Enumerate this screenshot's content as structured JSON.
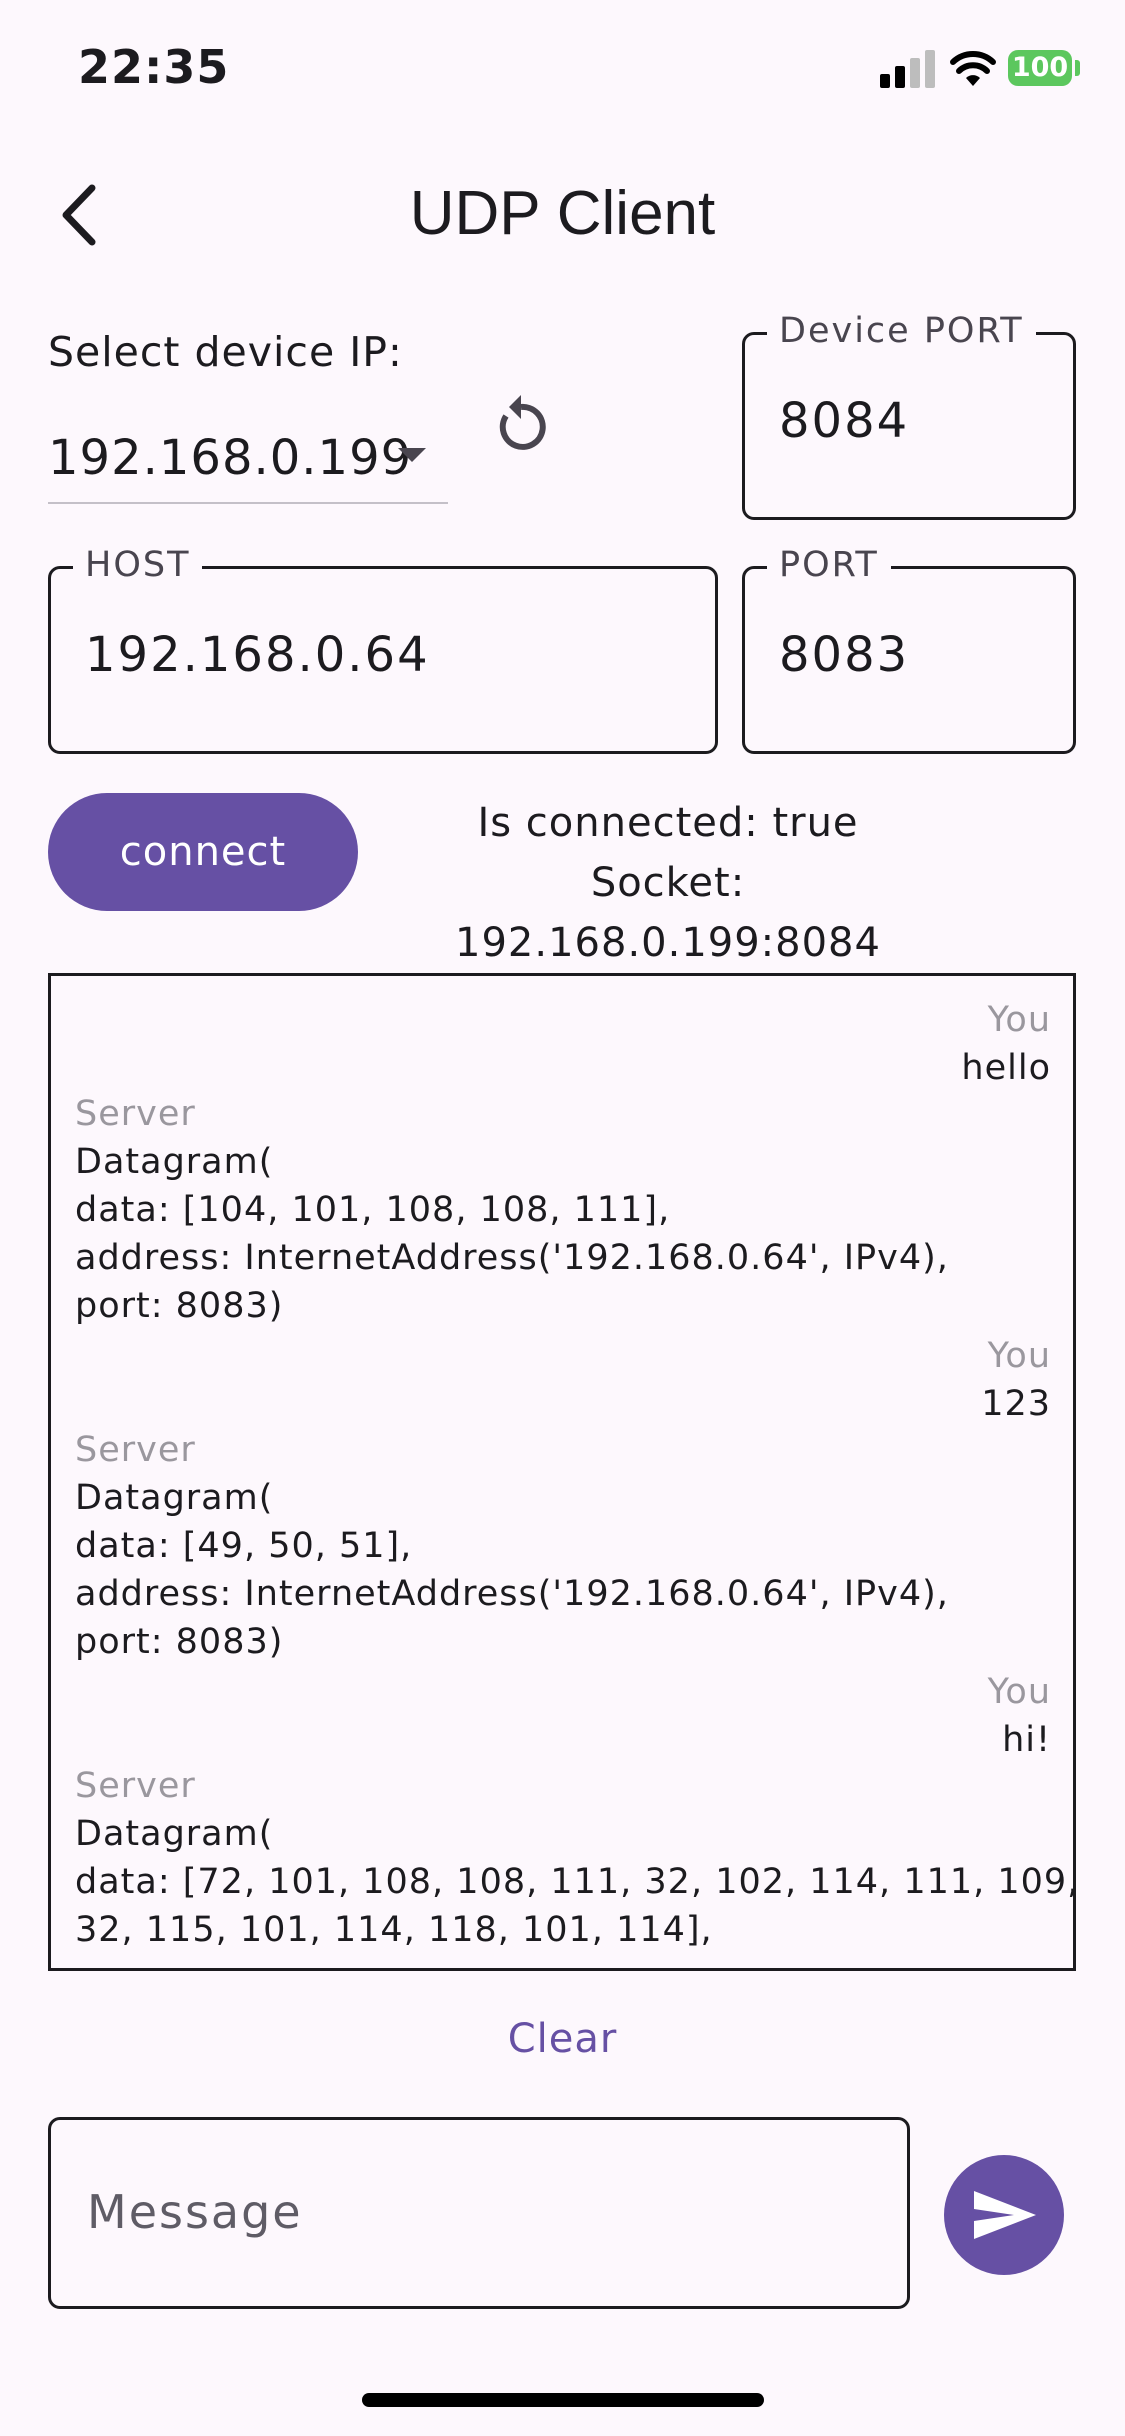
{
  "status_bar": {
    "time": "22:35",
    "battery": "100",
    "icons": [
      "signal-icon",
      "wifi-icon",
      "battery-icon"
    ]
  },
  "app_bar": {
    "title": "UDP Client",
    "back_icon": "chevron-left-icon"
  },
  "device_ip": {
    "label": "Select device IP:",
    "value": "192.168.0.199",
    "refresh_icon": "refresh-icon"
  },
  "device_port": {
    "label": "Device PORT",
    "value": "8084"
  },
  "host": {
    "label": "HOST",
    "value": "192.168.0.64"
  },
  "port": {
    "label": "PORT",
    "value": "8083"
  },
  "connect": {
    "label": "connect"
  },
  "connection": {
    "is_connected": "Is connected: true",
    "socket": "Socket: 192.168.0.199:8084"
  },
  "messages": [
    {
      "sender": "You",
      "text": "hello"
    },
    {
      "sender": "Server",
      "text": "Datagram(\ndata: [104, 101, 108, 108, 111],\naddress: InternetAddress('192.168.0.64', IPv4),\nport: 8083)"
    },
    {
      "sender": "You",
      "text": "123"
    },
    {
      "sender": "Server",
      "text": "Datagram(\ndata: [49, 50, 51],\naddress: InternetAddress('192.168.0.64', IPv4),\nport: 8083)"
    },
    {
      "sender": "You",
      "text": "hi!"
    },
    {
      "sender": "Server",
      "text": "Datagram(\ndata: [72, 101, 108, 108, 111, 32, 102, 114, 111, 109,\n32, 115, 101, 114, 118, 101, 114],"
    }
  ],
  "clear": {
    "label": "Clear"
  },
  "composer": {
    "placeholder": "Message",
    "send_icon": "send-icon"
  },
  "colors": {
    "accent": "#6650a4",
    "background": "#fdf8fd",
    "battery": "#5cc75e"
  }
}
